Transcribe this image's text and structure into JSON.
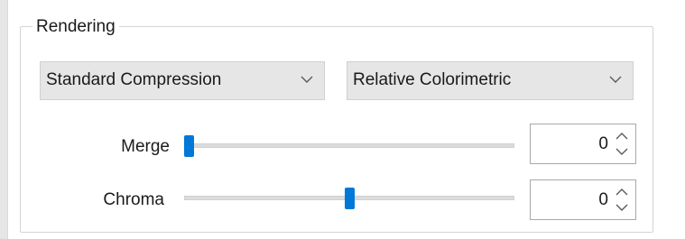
{
  "group": {
    "title": "Rendering"
  },
  "compression_select": {
    "value": "Standard Compression",
    "icon": "chevron-down-icon"
  },
  "intent_select": {
    "value": "Relative Colorimetric",
    "icon": "chevron-down-icon"
  },
  "merge": {
    "label": "Merge",
    "slider_fraction": 0.0,
    "spin_value": "0"
  },
  "chroma": {
    "label": "Chroma",
    "slider_fraction": 0.5,
    "spin_value": "0"
  },
  "colors": {
    "accent": "#0078d7",
    "track": "#dcdcdc",
    "combo_bg": "#e6e6e6"
  }
}
